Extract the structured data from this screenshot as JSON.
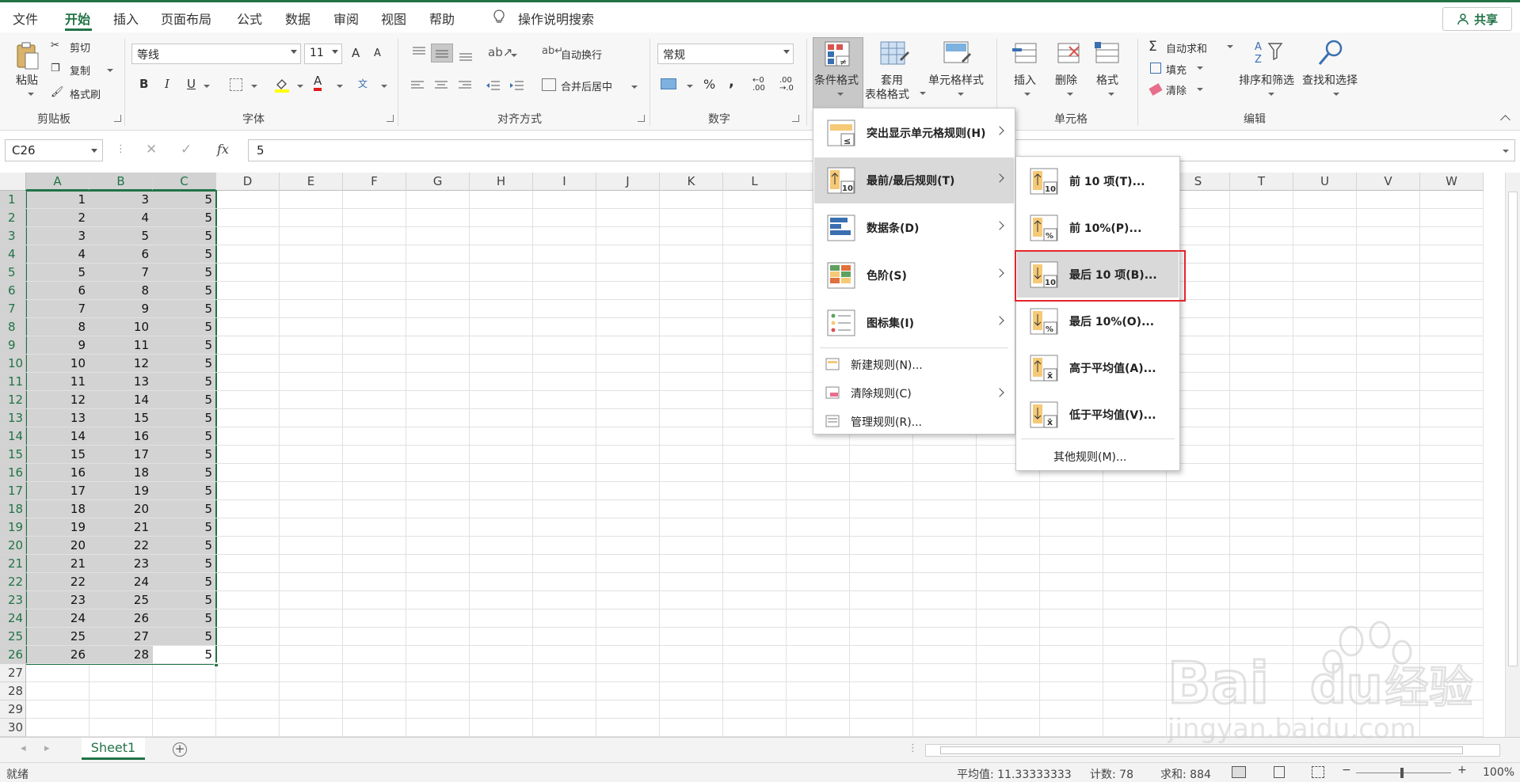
{
  "tabs": [
    "文件",
    "开始",
    "插入",
    "页面布局",
    "公式",
    "数据",
    "审阅",
    "视图",
    "帮助"
  ],
  "tell_me": "操作说明搜索",
  "share": "共享",
  "clipboard": {
    "paste": "粘贴",
    "cut": "剪切",
    "copy": "复制",
    "format_painter": "格式刷",
    "group": "剪贴板"
  },
  "font": {
    "name": "等线",
    "size": "11",
    "group": "字体",
    "bold": "B",
    "italic": "I",
    "underline": "U",
    "grow": "A",
    "shrink": "A",
    "font_color_glyph": "A",
    "phonetic_glyph": "文"
  },
  "alignment": {
    "wrap": "自动换行",
    "merge": "合并后居中",
    "group": "对齐方式"
  },
  "number": {
    "format": "常规",
    "group": "数字",
    "percent": "%",
    "comma": ","
  },
  "styles": {
    "conditional": "条件格式",
    "table_line1": "套用",
    "table_line2": "表格格式",
    "cell_styles": "单元格样式"
  },
  "cells": {
    "insert": "插入",
    "delete": "删除",
    "format": "格式",
    "group": "单元格"
  },
  "editing": {
    "autosum": "自动求和",
    "fill": "填充",
    "clear": "清除",
    "sort": "排序和筛选",
    "find": "查找和选择",
    "group": "编辑"
  },
  "formula_bar": {
    "name_box": "C26",
    "fx": "fx",
    "value": "5"
  },
  "columns": [
    "A",
    "B",
    "C",
    "D",
    "E",
    "F",
    "G",
    "H",
    "I",
    "J",
    "K",
    "L",
    "M",
    "N",
    "O",
    "P",
    "Q",
    "R",
    "S",
    "T",
    "U",
    "V",
    "W"
  ],
  "rows": [
    "1",
    "2",
    "3",
    "4",
    "5",
    "6",
    "7",
    "8",
    "9",
    "10",
    "11",
    "12",
    "13",
    "14",
    "15",
    "16",
    "17",
    "18",
    "19",
    "20",
    "21",
    "22",
    "23",
    "24",
    "25",
    "26",
    "27",
    "28",
    "29",
    "30"
  ],
  "data": {
    "A": [
      1,
      2,
      3,
      4,
      5,
      6,
      7,
      8,
      9,
      10,
      11,
      12,
      13,
      14,
      15,
      16,
      17,
      18,
      19,
      20,
      21,
      22,
      23,
      24,
      25,
      26
    ],
    "B": [
      3,
      4,
      5,
      6,
      7,
      8,
      9,
      10,
      11,
      12,
      13,
      14,
      15,
      16,
      17,
      18,
      19,
      20,
      21,
      22,
      23,
      24,
      25,
      26,
      27,
      28
    ],
    "C": [
      5,
      5,
      5,
      5,
      5,
      5,
      5,
      5,
      5,
      5,
      5,
      5,
      5,
      5,
      5,
      5,
      5,
      5,
      5,
      5,
      5,
      5,
      5,
      5,
      5,
      5
    ]
  },
  "sheet_tab": "Sheet1",
  "status": {
    "ready": "就绪",
    "average": "平均值: 11.33333333",
    "count": "计数: 78",
    "sum": "求和: 884",
    "zoom": "100%"
  },
  "cf_menu": {
    "items": [
      {
        "label": "突出显示单元格规则(H)",
        "key": "H"
      },
      {
        "label": "最前/最后规则(T)",
        "key": "T"
      },
      {
        "label": "数据条(D)",
        "key": "D"
      },
      {
        "label": "色阶(S)",
        "key": "S"
      },
      {
        "label": "图标集(I)",
        "key": "I"
      }
    ],
    "new_rule": "新建规则(N)...",
    "clear_rules": "清除规则(C)",
    "manage_rules": "管理规则(R)..."
  },
  "topbottom_menu": {
    "items": [
      "前 10 项(T)...",
      "前 10%(P)...",
      "最后 10 项(B)...",
      "最后 10%(O)...",
      "高于平均值(A)...",
      "低于平均值(V)..."
    ],
    "more": "其他规则(M)..."
  },
  "watermark": "Baidu经验 jingyan.baidu.com",
  "colors": {
    "accent": "#217346",
    "highlight": "#e4262c"
  }
}
